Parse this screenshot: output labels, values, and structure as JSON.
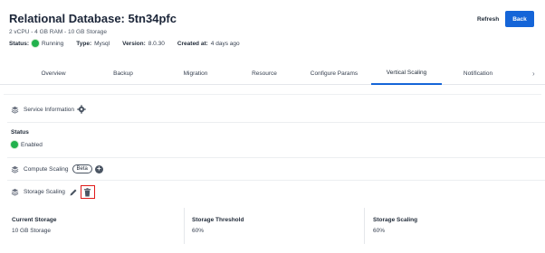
{
  "header": {
    "title": "Relational Database: 5tn34pfc",
    "subtitle": "2 vCPU - 4 GB RAM - 10 GB Storage",
    "status_label": "Status:",
    "status_value": "Running",
    "type_label": "Type:",
    "type_value": "Mysql",
    "version_label": "Version:",
    "version_value": "8.0.30",
    "created_label": "Created at:",
    "created_value": "4 days ago",
    "refresh_label": "Refresh",
    "back_label": "Back",
    "status_color": "#22b14c",
    "accent_color": "#1565d8"
  },
  "tabs": {
    "items": [
      {
        "label": "Overview"
      },
      {
        "label": "Backup"
      },
      {
        "label": "Migration"
      },
      {
        "label": "Resource"
      },
      {
        "label": "Configure Params"
      },
      {
        "label": "Vertical Scaling"
      },
      {
        "label": "Notification"
      }
    ],
    "active": "Vertical Scaling",
    "more_icon": "chevron-right-icon"
  },
  "panel": {
    "service_info_label": "Service Information",
    "status_heading": "Status",
    "status_value": "Enabled",
    "compute_scaling_label": "Compute Scaling",
    "beta_label": "Beta",
    "storage_scaling_label": "Storage Scaling",
    "highlight_color": "#e01a1a"
  },
  "stats": [
    {
      "label": "Current Storage",
      "value": "10 GB Storage"
    },
    {
      "label": "Storage Threshold",
      "value": "60%"
    },
    {
      "label": "Storage Scaling",
      "value": "60%"
    }
  ]
}
